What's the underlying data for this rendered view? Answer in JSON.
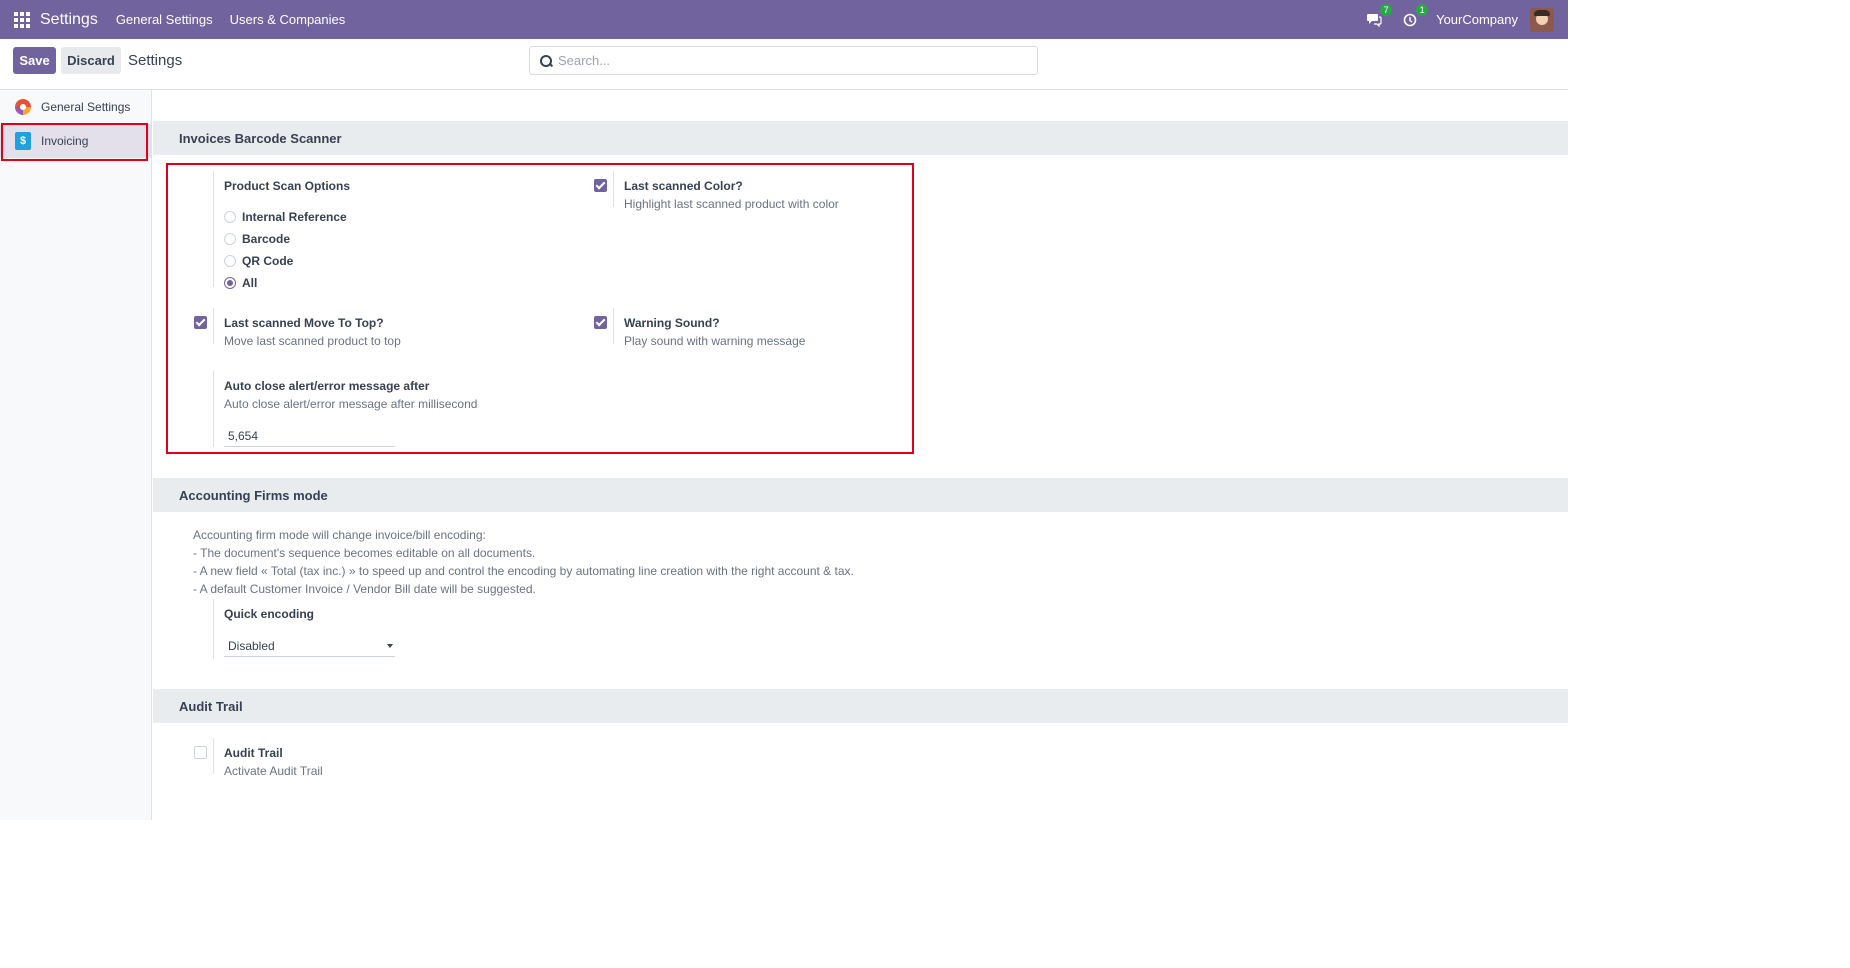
{
  "navbar": {
    "app_title": "Settings",
    "links": [
      "General Settings",
      "Users & Companies"
    ],
    "messages_count": "7",
    "activities_count": "1",
    "company": "YourCompany"
  },
  "control": {
    "save": "Save",
    "discard": "Discard",
    "title": "Settings",
    "search_placeholder": "Search..."
  },
  "sidebar": {
    "items": [
      {
        "label": "General Settings",
        "icon": "general-settings-logo-icon"
      },
      {
        "label": "Invoicing",
        "icon": "invoicing-logo-icon",
        "active": true
      }
    ]
  },
  "barcode": {
    "section": "Invoices Barcode Scanner",
    "scan_options_title": "Product Scan Options",
    "scan_options": [
      "Internal Reference",
      "Barcode",
      "QR Code",
      "All"
    ],
    "scan_selected": "All",
    "color_title": "Last scanned Color?",
    "color_desc": "Highlight last scanned product with color",
    "color_checked": true,
    "top_title": "Last scanned Move To Top?",
    "top_desc": "Move last scanned product to top",
    "top_checked": true,
    "sound_title": "Warning Sound?",
    "sound_desc": "Play sound with warning message",
    "sound_checked": true,
    "auto_title": "Auto close alert/error message after",
    "auto_desc": "Auto close alert/error message after millisecond",
    "auto_value": "5,654"
  },
  "firms": {
    "section": "Accounting Firms mode",
    "lines": [
      "Accounting firm mode will change invoice/bill encoding:",
      "- The document's sequence becomes editable on all documents.",
      "- A new field « Total (tax inc.) » to speed up and control the encoding by automating line creation with the right account & tax.",
      "- A default Customer Invoice / Vendor Bill date will be suggested."
    ],
    "quick_title": "Quick encoding",
    "quick_value": "Disabled"
  },
  "audit": {
    "section": "Audit Trail",
    "title": "Audit Trail",
    "desc": "Activate Audit Trail",
    "checked": false
  },
  "colors": {
    "brand": "#71639e",
    "highlight": "#e0001a"
  }
}
